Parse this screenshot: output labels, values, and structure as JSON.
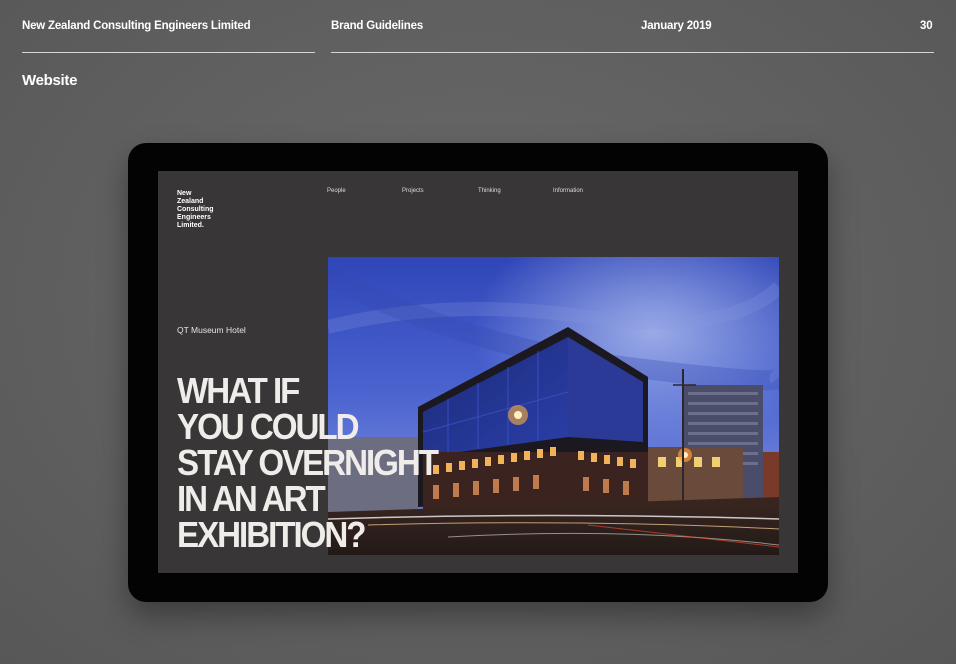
{
  "header": {
    "company": "New Zealand Consulting Engineers Limited",
    "document": "Brand Guidelines",
    "date": "January 2019",
    "page_number": "30"
  },
  "section_title": "Website",
  "mockup": {
    "logo_lines": [
      "New",
      "Zealand",
      "Consulting",
      "Engineers",
      "Limited."
    ],
    "nav": [
      "People",
      "Projects",
      "Thinking",
      "Information"
    ],
    "project_label": "QT Museum Hotel",
    "headline_lines": [
      "WHAT IF",
      "YOU COULD",
      "STAY OVERNIGHT",
      "IN AN ART",
      "EXHIBITION?"
    ]
  }
}
